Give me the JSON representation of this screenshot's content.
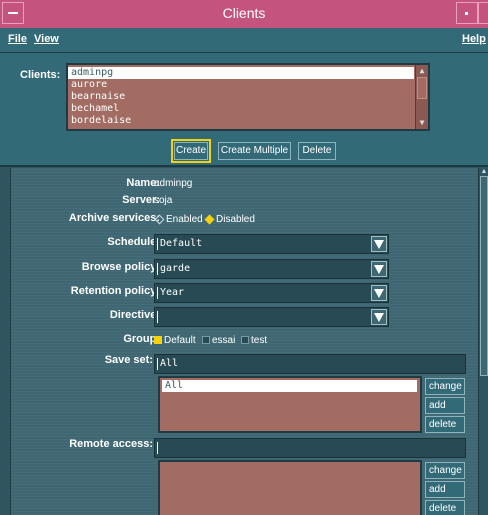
{
  "window": {
    "title": "Clients"
  },
  "menubar": {
    "file": "File",
    "view": "View",
    "help": "Help"
  },
  "clients": {
    "label": "Clients:",
    "items": [
      "adminpg",
      "aurore",
      "bearnaise",
      "bechamel",
      "bordelaise"
    ],
    "selected": "adminpg"
  },
  "actions": {
    "create": "Create",
    "create_multiple": "Create Multiple",
    "delete": "Delete"
  },
  "form": {
    "name_label": "Name:",
    "name_value": "adminpg",
    "server_label": "Server:",
    "server_value": "soja",
    "archive_label": "Archive services:",
    "archive_enabled": "Enabled",
    "archive_disabled": "Disabled",
    "archive_selected": "Disabled",
    "schedule_label": "Schedule:",
    "schedule_value": "Default",
    "browse_label": "Browse policy:",
    "browse_value": "garde",
    "retention_label": "Retention policy:",
    "retention_value": "Year",
    "directive_label": "Directive:",
    "directive_value": "",
    "group_label": "Group:",
    "groups": [
      "Default",
      "essai",
      "test"
    ],
    "group_checked": [
      "Default"
    ],
    "saveset_label": "Save set:",
    "saveset_input": "All",
    "saveset_items": [
      "All"
    ],
    "remote_label": "Remote access:",
    "remote_input": "",
    "remote_items": [],
    "change": "change",
    "add": "add",
    "delete": "delete"
  },
  "colors": {
    "accent": "#f2d20e",
    "titlebar": "#c4547e",
    "background": "#336a78",
    "list": "#a26c62"
  }
}
